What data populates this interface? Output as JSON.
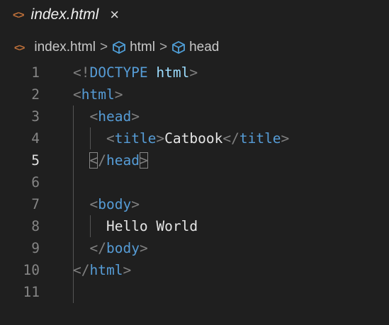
{
  "tab": {
    "icon": "html-code-icon",
    "label": "index.html",
    "close": "×"
  },
  "breadcrumb": {
    "file": "index.html",
    "items": [
      "html",
      "head"
    ],
    "separator": ">"
  },
  "editor": {
    "current_line": 5,
    "lines": [
      {
        "n": "1",
        "tokens": [
          {
            "t": "<!",
            "c": "b"
          },
          {
            "t": "DOCTYPE",
            "c": "tg"
          },
          {
            "t": " ",
            "c": "tx"
          },
          {
            "t": "html",
            "c": "kw"
          },
          {
            "t": ">",
            "c": "b"
          }
        ]
      },
      {
        "n": "2",
        "tokens": [
          {
            "t": "<",
            "c": "b"
          },
          {
            "t": "html",
            "c": "tg"
          },
          {
            "t": ">",
            "c": "b"
          }
        ]
      },
      {
        "n": "3",
        "tokens": [
          {
            "t": "  ",
            "c": "tx"
          },
          {
            "t": "<",
            "c": "b"
          },
          {
            "t": "head",
            "c": "tg"
          },
          {
            "t": ">",
            "c": "b"
          }
        ]
      },
      {
        "n": "4",
        "tokens": [
          {
            "t": "    ",
            "c": "tx"
          },
          {
            "t": "<",
            "c": "b"
          },
          {
            "t": "title",
            "c": "tg"
          },
          {
            "t": ">",
            "c": "b"
          },
          {
            "t": "Catbook",
            "c": "tx"
          },
          {
            "t": "</",
            "c": "b"
          },
          {
            "t": "title",
            "c": "tg"
          },
          {
            "t": ">",
            "c": "b"
          }
        ]
      },
      {
        "n": "5",
        "tokens": [
          {
            "t": "  ",
            "c": "tx"
          },
          {
            "t": "<",
            "c": "b bm"
          },
          {
            "t": "/",
            "c": "b"
          },
          {
            "t": "head",
            "c": "tg"
          },
          {
            "t": ">",
            "c": "b bm"
          }
        ]
      },
      {
        "n": "6",
        "tokens": []
      },
      {
        "n": "7",
        "tokens": [
          {
            "t": "  ",
            "c": "tx"
          },
          {
            "t": "<",
            "c": "b"
          },
          {
            "t": "body",
            "c": "tg"
          },
          {
            "t": ">",
            "c": "b"
          }
        ]
      },
      {
        "n": "8",
        "tokens": [
          {
            "t": "    ",
            "c": "tx"
          },
          {
            "t": "Hello World",
            "c": "tx"
          }
        ]
      },
      {
        "n": "9",
        "tokens": [
          {
            "t": "  ",
            "c": "tx"
          },
          {
            "t": "</",
            "c": "b"
          },
          {
            "t": "body",
            "c": "tg"
          },
          {
            "t": ">",
            "c": "b"
          }
        ]
      },
      {
        "n": "10",
        "tokens": [
          {
            "t": "</",
            "c": "b"
          },
          {
            "t": "html",
            "c": "tg"
          },
          {
            "t": ">",
            "c": "b"
          }
        ]
      },
      {
        "n": "11",
        "tokens": []
      }
    ]
  }
}
